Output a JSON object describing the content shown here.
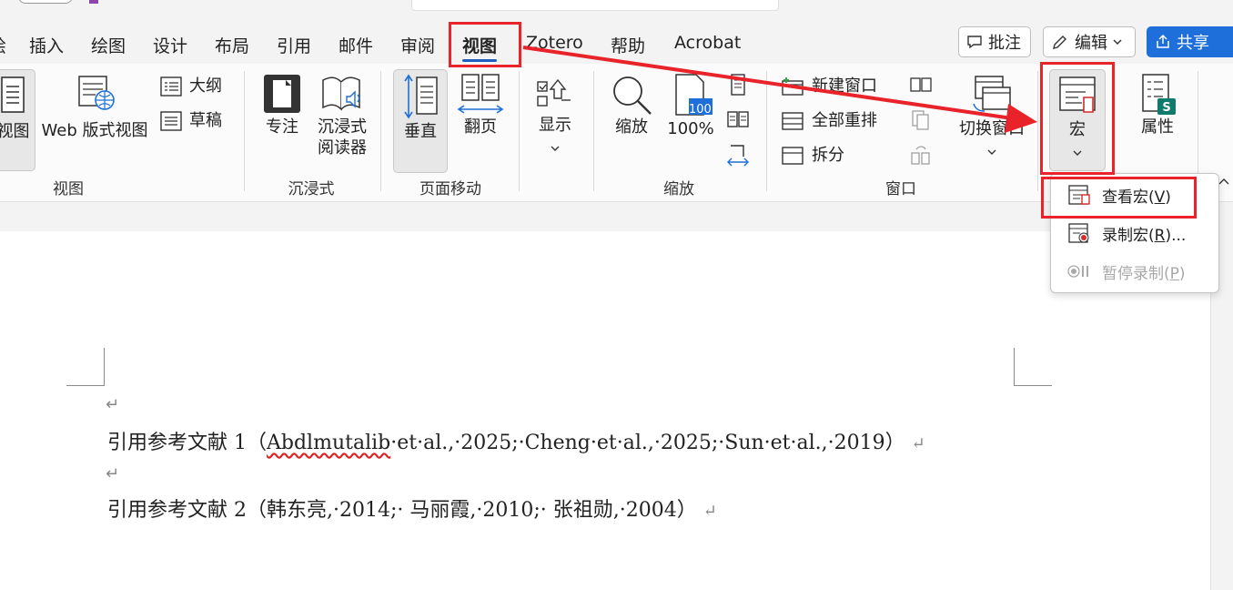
{
  "tabs": [
    {
      "label": "绘",
      "id": "draw-partial"
    },
    {
      "label": "插入",
      "id": "insert"
    },
    {
      "label": "绘图",
      "id": "drawing"
    },
    {
      "label": "设计",
      "id": "design"
    },
    {
      "label": "布局",
      "id": "layout"
    },
    {
      "label": "引用",
      "id": "references"
    },
    {
      "label": "邮件",
      "id": "mailings"
    },
    {
      "label": "审阅",
      "id": "review"
    },
    {
      "label": "视图",
      "id": "view",
      "active": true
    },
    {
      "label": "Zotero",
      "id": "zotero"
    },
    {
      "label": "帮助",
      "id": "help"
    },
    {
      "label": "Acrobat",
      "id": "acrobat"
    }
  ],
  "top_buttons": {
    "comments": "批注",
    "editing": "编辑",
    "share": "共享"
  },
  "ribbon": {
    "views_group": {
      "label": "视图",
      "print_layout": "视图",
      "web_layout": "Web 版式视图",
      "outline": "大纲",
      "draft": "草稿"
    },
    "immersive_group": {
      "label": "沉浸式",
      "focus": "专注",
      "immersive_reader": "沉浸式阅读器"
    },
    "page_movement_group": {
      "label": "页面移动",
      "vertical": "垂直",
      "side_to_side": "翻页"
    },
    "show_group": {
      "show": "显示"
    },
    "zoom_group": {
      "label": "缩放",
      "zoom": "缩放",
      "hundred_percent": "100%",
      "hundred_badge": "100"
    },
    "window_group": {
      "label": "窗口",
      "new_window": "新建窗口",
      "arrange_all": "全部重排",
      "split": "拆分",
      "switch_windows": "切换窗口"
    },
    "macros": {
      "label": "宏"
    },
    "properties": {
      "label": "属性"
    }
  },
  "macro_menu": {
    "view_macros": {
      "text": "查看宏(",
      "key": "V",
      "tail": ")"
    },
    "record_macro": {
      "text": "录制宏(",
      "key": "R",
      "tail": ")..."
    },
    "pause_recording": {
      "text": "暂停录制(",
      "key": "P",
      "tail": ")"
    }
  },
  "document": {
    "line1": {
      "prefix": "引用参考文献 1（",
      "squiggle": "Abdlmutalib",
      "rest": "·et·al.,·2025;·Cheng·et·al.,·2025;·Sun·et·al.,·2019）"
    },
    "line2": "引用参考文献 2（韩东亮,·2014;· 马丽霞,·2010;· 张祖勋,·2004）",
    "paragraph_mark": "↵"
  },
  "colors": {
    "annotation_red": "#e8232a",
    "accent_blue": "#1e6fd9",
    "share_sharepoint_green": "#0f7b6c"
  }
}
